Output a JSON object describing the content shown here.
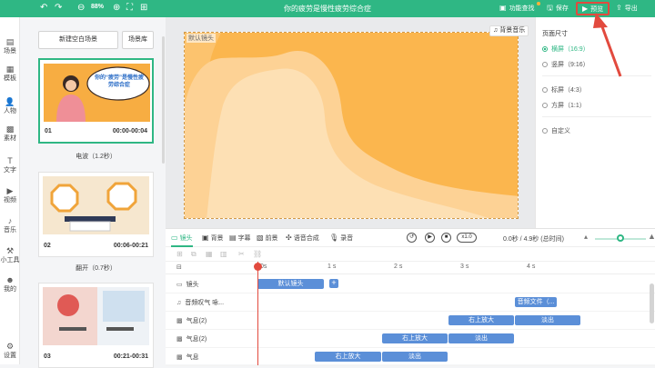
{
  "topbar": {
    "zoom": "88%",
    "title": "你的疲劳是慢性疲劳综合症",
    "feature_guide": "功能查找",
    "save": "保存",
    "preview": "预览",
    "export": "导出"
  },
  "nav": [
    {
      "label": "场景",
      "icon": "scene-icon"
    },
    {
      "label": "模板",
      "icon": "template-icon"
    },
    {
      "label": "人物",
      "icon": "person-icon"
    },
    {
      "label": "素材",
      "icon": "material-icon"
    },
    {
      "label": "文字",
      "icon": "text-icon"
    },
    {
      "label": "视频",
      "icon": "video-icon"
    },
    {
      "label": "音乐",
      "icon": "music-icon"
    },
    {
      "label": "小工具",
      "icon": "tools-icon"
    },
    {
      "label": "我的",
      "icon": "mine-icon"
    },
    {
      "label": "设置",
      "icon": "settings-icon"
    }
  ],
  "scenes": {
    "new_blank": "新建空白场景",
    "library": "场景库",
    "items": [
      {
        "num": "01",
        "time": "00:00-00:04",
        "thumb_text": "你的“疲劳”是慢性疲劳综合症",
        "transition": "电波（1.2秒）"
      },
      {
        "num": "02",
        "time": "00:06-00:21",
        "transition": "翻开（0.7秒）"
      },
      {
        "num": "03",
        "time": "00:21-00:31"
      }
    ]
  },
  "canvas": {
    "tag": "默认镜头",
    "bg_music": "背景音乐"
  },
  "page_size": {
    "heading": "页面尺寸",
    "options": [
      {
        "label": "横屏（16:9）",
        "selected": true
      },
      {
        "label": "竖屏（9:16）",
        "selected": false
      },
      {
        "label": "标屏（4:3）",
        "selected": false
      },
      {
        "label": "方屏（1:1）",
        "selected": false
      },
      {
        "label": "自定义",
        "selected": false
      }
    ]
  },
  "timeline": {
    "tools": [
      "镜头",
      "背景",
      "字幕",
      "前景",
      "语音合成",
      "录音"
    ],
    "speed": "x1.0",
    "time_readout": "0.0秒 / 4.9秒",
    "total_label": "(总时间)",
    "ruler": [
      "0s",
      "1 s",
      "2 s",
      "3 s",
      "4 s"
    ],
    "rows": [
      {
        "label": "镜头",
        "icon": "camera-icon"
      },
      {
        "label": "音频叹气 咏...",
        "icon": "audio-icon"
      },
      {
        "label": "气息(2)",
        "icon": "image-icon"
      },
      {
        "label": "气息(2)",
        "icon": "image-icon"
      },
      {
        "label": "气息",
        "icon": "image-icon"
      }
    ],
    "clips": {
      "camera": "默认镜头",
      "audio": "音频文件（...",
      "r3a": "右上放大",
      "r3b": "淡出",
      "r4a": "右上放大",
      "r4b": "淡出",
      "r5a": "右上放大",
      "r5b": "淡出"
    }
  },
  "colors": {
    "brand": "#2fb784",
    "clip": "#5b8fd8",
    "playhead": "#e24a3e",
    "scene_bg": "#f7ad42"
  }
}
